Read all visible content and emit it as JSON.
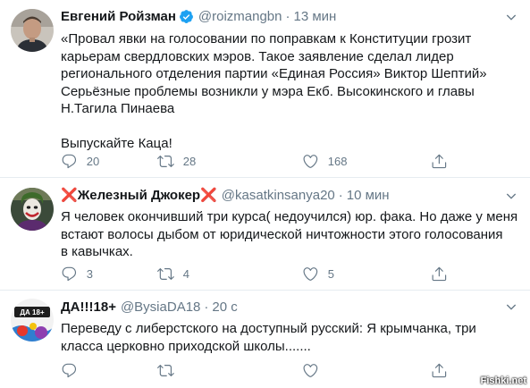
{
  "tweets": [
    {
      "name": "Евгений Ройзман",
      "verified": true,
      "handle": "@roizmangbn",
      "separator": "·",
      "time": "13 мин",
      "lines": [
        "«Провал явки на голосовании по поправкам к Конституции грозит",
        "карьерам свердловских мэров. Такое заявление сделал лидер",
        "регионального отделения партии «Единая Россия» Виктор Шептий»",
        "Серьёзные проблемы возникли у мэра Екб. Высокинского и главы",
        "Н.Тагила Пинаева",
        "",
        "Выпускайте Каца!"
      ],
      "replies": "20",
      "retweets": "28",
      "likes": "168"
    },
    {
      "name_prefix": "❌",
      "name": "Железный Джокер",
      "name_suffix": "❌",
      "handle": "@kasatkinsanya20",
      "separator": "·",
      "time": "10 мин",
      "lines": [
        "Я человек окончивший три курса( недоучился) юр. фака. Но даже у меня",
        "встают волосы дыбом от юридической ничтожности этого голосования",
        "в кавычках."
      ],
      "replies": "3",
      "retweets": "4",
      "likes": "5"
    },
    {
      "name": "ДА!!!18+",
      "handle": "@BysiaDA18",
      "separator": "·",
      "time": "20 с",
      "lines": [
        "Переведу с либерстского на доступный русский: Я крымчанка, три",
        "класса церковно приходской школы......."
      ],
      "replies": "",
      "retweets": "",
      "likes": ""
    }
  ],
  "avatar_badge_text": "ДА 18+",
  "watermark": "Fishki.net",
  "colors": {
    "text": "#14171a",
    "secondary": "#657786",
    "verified": "#1da1f2",
    "divider": "#e6ecf0",
    "cross": "#e0245e"
  },
  "icons": [
    "verified-badge-icon",
    "chevron-down-icon",
    "reply-icon",
    "retweet-icon",
    "like-icon",
    "share-icon"
  ]
}
